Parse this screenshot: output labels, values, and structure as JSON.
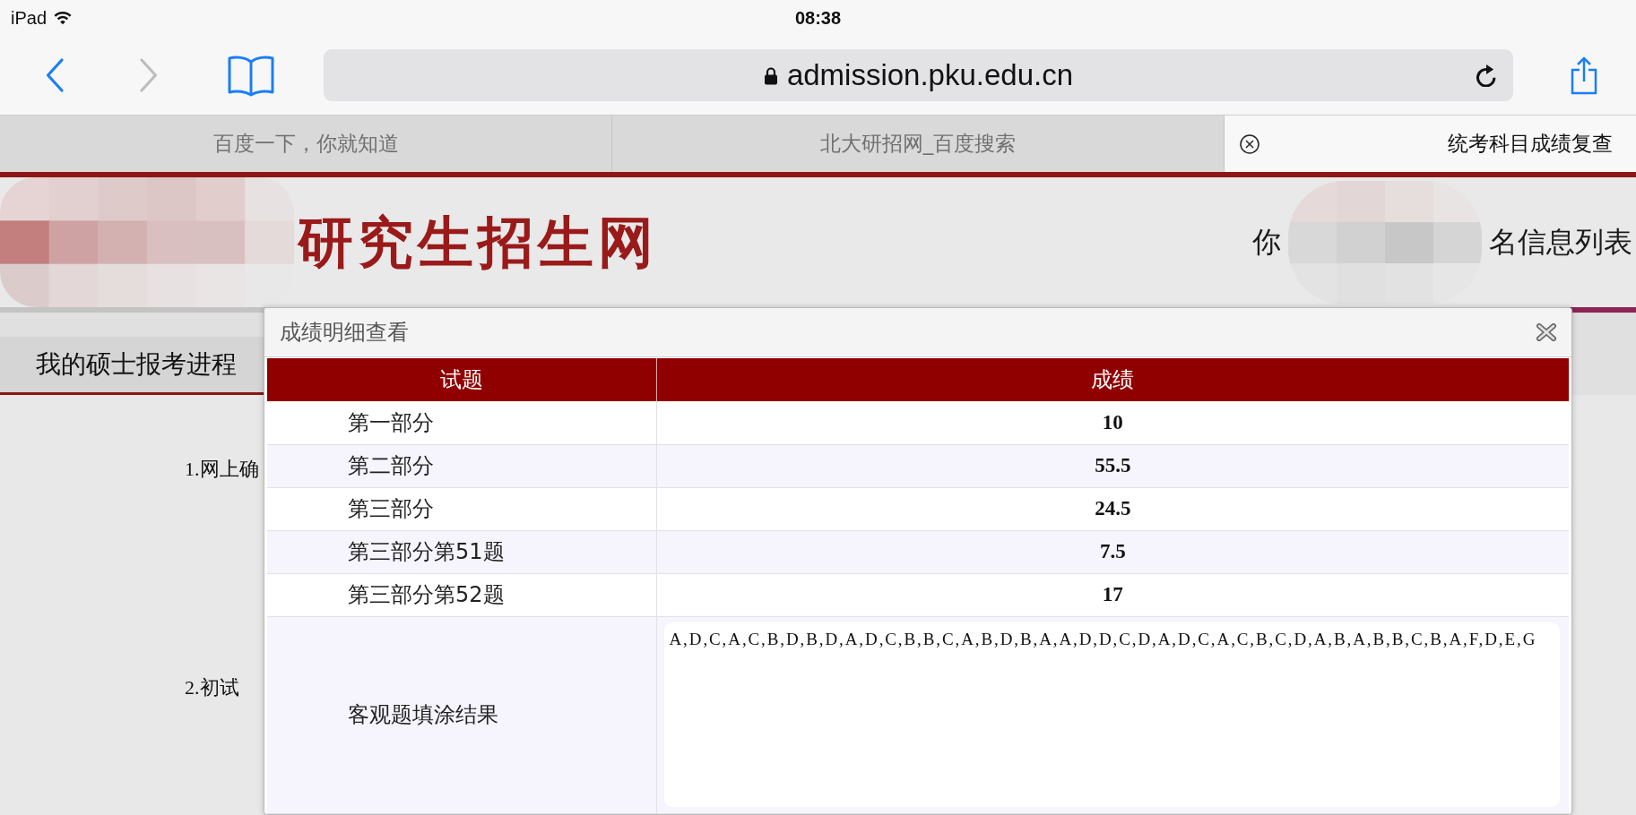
{
  "status_bar": {
    "device": "iPad",
    "time": "08:38"
  },
  "toolbar": {
    "back_enabled": true,
    "forward_enabled": false,
    "url": "admission.pku.edu.cn"
  },
  "browser_tabs": [
    {
      "title": "百度一下，你就知道",
      "selected": false
    },
    {
      "title": "北大研招网_百度搜索",
      "selected": false
    },
    {
      "title": "统考科目成绩复查",
      "selected": true
    }
  ],
  "site_header": {
    "title": "研究生招生网",
    "text_before_redaction": "你",
    "text_after_redaction": "名信息列表"
  },
  "nav_tabs": [
    {
      "label": "我的硕士报考进程",
      "selected": true
    }
  ],
  "steps": [
    "1.网上确",
    "2.初试"
  ],
  "dialog": {
    "title": "成绩明细查看",
    "columns": [
      "试题",
      "成绩"
    ],
    "rows": [
      {
        "kind": "score",
        "item": "第一部分",
        "score": "10"
      },
      {
        "kind": "score",
        "item": "第二部分",
        "score": "55.5"
      },
      {
        "kind": "score",
        "item": "第三部分",
        "score": "24.5"
      },
      {
        "kind": "score",
        "item": "第三部分第51题",
        "score": "7.5"
      },
      {
        "kind": "score",
        "item": "第三部分第52题",
        "score": "17"
      },
      {
        "kind": "answer_sheet",
        "item": "客观题填涂结果",
        "answers": "A,D,C,A,C,B,D,B,D,A,D,C,B,B,C,A,B,D,B,A,A,D,D,C,D,A,D,C,A,C,B,C,D,A,B,A,B,B,C,B,A,F,D,E,G"
      }
    ]
  }
}
